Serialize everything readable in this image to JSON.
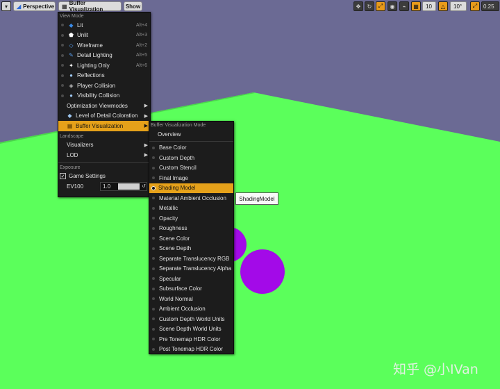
{
  "toolbar": {
    "menu_arrow": "▾",
    "perspective_label": "Perspective",
    "buffer_vis_label": "Buffer Visualization",
    "show_label": "Show",
    "grid_value": "10",
    "angle_value": "10°",
    "scale_value": "0.25"
  },
  "view_menu": {
    "view_mode_header": "View Mode",
    "items": [
      {
        "label": "Lit",
        "shortcut": "Alt+4"
      },
      {
        "label": "Unlit",
        "shortcut": "Alt+3"
      },
      {
        "label": "Wireframe",
        "shortcut": "Alt+2"
      },
      {
        "label": "Detail Lighting",
        "shortcut": "Alt+5"
      },
      {
        "label": "Lighting Only",
        "shortcut": "Alt+6"
      },
      {
        "label": "Reflections",
        "shortcut": ""
      },
      {
        "label": "Player Collision",
        "shortcut": ""
      },
      {
        "label": "Visibility Collision",
        "shortcut": ""
      },
      {
        "label": "Optimization Viewmodes",
        "shortcut": ""
      },
      {
        "label": "Level of Detail Coloration",
        "shortcut": ""
      },
      {
        "label": "Buffer Visualization",
        "shortcut": ""
      }
    ],
    "landscape_header": "Landscape",
    "visualizers_label": "Visualizers",
    "lod_label": "LOD",
    "exposure_header": "Exposure",
    "game_settings_label": "Game Settings",
    "game_settings_checked": true,
    "ev100_label": "EV100",
    "ev100_value": "1.0"
  },
  "buffer_menu": {
    "header": "Buffer Visualization Mode",
    "overview_label": "Overview",
    "items": [
      "Base Color",
      "Custom Depth",
      "Custom Stencil",
      "Final Image",
      "Shading Model",
      "Material Ambient Occlusion",
      "Metallic",
      "Opacity",
      "Roughness",
      "Scene Color",
      "Scene Depth",
      "Separate Translucency RGB",
      "Separate Translucency Alpha",
      "Specular",
      "Subsurface Color",
      "World Normal",
      "Ambient Occlusion",
      "Custom Depth World Units",
      "Scene Depth World Units",
      "Pre Tonemap HDR Color",
      "Post Tonemap HDR Color"
    ],
    "selected": "Shading Model"
  },
  "tooltip": {
    "text": "ShadingModel"
  },
  "watermark": {
    "text": "知乎 @小IVan"
  },
  "colors": {
    "sky": "#6b6a94",
    "ground": "#5bff5b",
    "sphere": "#a30ae8",
    "accent": "#e5a11a"
  }
}
